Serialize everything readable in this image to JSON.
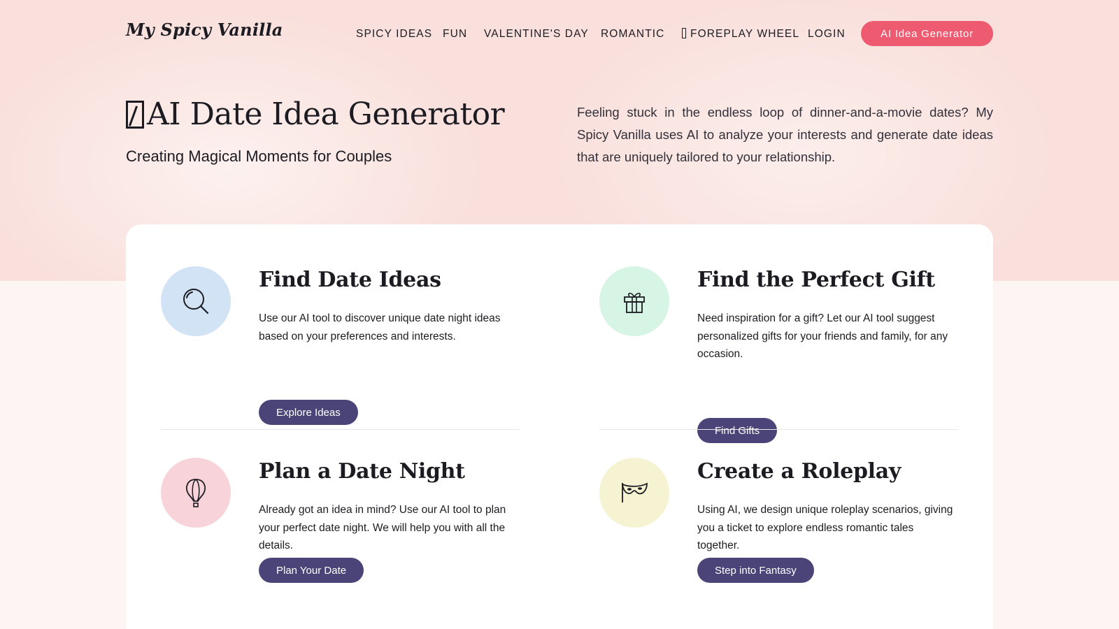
{
  "header": {
    "logo": "My Spicy Vanilla",
    "nav": [
      {
        "label": "SPICY IDEAS"
      },
      {
        "label": "FUN"
      },
      {
        "label": "VALENTINE'S DAY"
      },
      {
        "label": "ROMANTIC"
      },
      {
        "label": "FOREPLAY WHEEL",
        "icon": "wheel-icon"
      },
      {
        "label": "LOGIN"
      }
    ],
    "cta_label": "AI Idea Generator"
  },
  "hero": {
    "title": "AI Date Idea Generator",
    "subtitle": "Creating Magical Moments for Couples",
    "description": "Feeling stuck in the endless loop of dinner-and-a-movie dates? My Spicy Vanilla uses AI to analyze your interests and generate date ideas that are uniquely tailored to your relationship."
  },
  "features": [
    {
      "title": "Find Date Ideas",
      "text": "Use our AI tool to discover unique date night ideas based on your preferences and interests.",
      "button": "Explore Ideas",
      "icon": "magnifier-icon",
      "color": "#d3e3f6"
    },
    {
      "title": "Find the Perfect Gift",
      "text": "Need inspiration for a gift? Let our AI tool suggest personalized gifts for your friends and family, for any occasion.",
      "button": "Find Gifts",
      "icon": "gift-icon",
      "color": "#d6f5e5"
    },
    {
      "title": "Plan a Date Night",
      "text": "Already got an idea in mind? Use our AI tool to plan your perfect date night. We will help you with all the details.",
      "button": "Plan Your Date",
      "icon": "hot-air-balloon-icon",
      "color": "#f8d4da"
    },
    {
      "title": "Create a Roleplay",
      "text": "Using AI, we design unique roleplay scenarios, giving you a ticket to explore endless romantic tales together.",
      "button": "Step into Fantasy",
      "icon": "mask-icon",
      "color": "#f6f3d2"
    }
  ],
  "colors": {
    "cta": "#ee5a6f",
    "button": "#4b4479",
    "hero_bg": "#f9e0dc"
  }
}
